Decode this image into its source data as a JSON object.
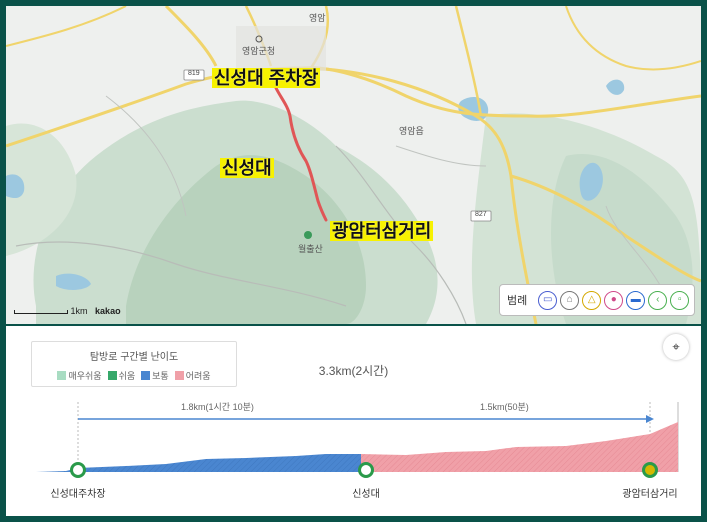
{
  "map": {
    "place_labels": {
      "county_office": "영암군청",
      "town": "영암",
      "eup": "영암읍",
      "mountain": "월출산"
    },
    "road_badges": {
      "r819": "819",
      "r827": "827"
    },
    "annotations": {
      "parking": "신성대 주차장",
      "sinseongdae": "신성대",
      "intersection": "광암터삼거리"
    },
    "scale": "1km",
    "brand": "kakao",
    "legend": {
      "title": "범례",
      "icons": [
        "bus-icon",
        "home-icon",
        "bell-icon",
        "person-icon",
        "car-icon",
        "share-icon",
        "lock-icon"
      ]
    },
    "colors": {
      "route": "#e05656",
      "map_bg": "#eef0ee",
      "forest": "#c7dccb",
      "road_yellow": "#f0d46b",
      "water": "#9cc8e0"
    }
  },
  "profile": {
    "difficulty": {
      "title": "탐방로 구간별 난이도",
      "levels": [
        {
          "label": "매우쉬움",
          "color": "#a8dcc2"
        },
        {
          "label": "쉬움",
          "color": "#36a86a"
        },
        {
          "label": "보통",
          "color": "#4a86d0"
        },
        {
          "label": "어려움",
          "color": "#f0a0a8"
        }
      ]
    },
    "summary": "3.3km(2시간)",
    "segments": [
      "1.8km(1시간 10분)",
      "1.5km(50분)"
    ],
    "points": [
      "신성대주차장",
      "신성대",
      "광암터삼거리"
    ]
  }
}
